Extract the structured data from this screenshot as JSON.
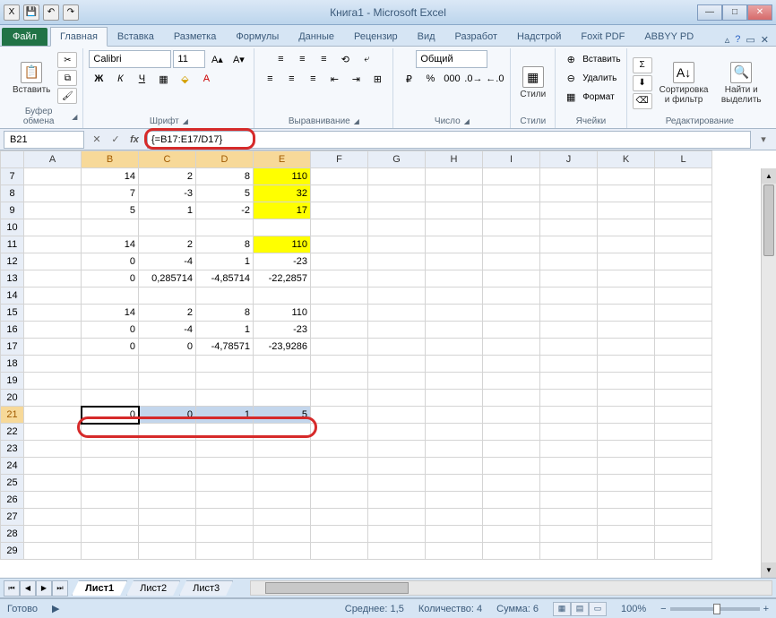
{
  "window": {
    "title": "Книга1 - Microsoft Excel"
  },
  "qat": {
    "save": "💾",
    "undo": "↶",
    "redo": "↷"
  },
  "tabs": {
    "file": "Файл",
    "items": [
      "Главная",
      "Вставка",
      "Разметка",
      "Формулы",
      "Данные",
      "Рецензир",
      "Вид",
      "Разработ",
      "Надстрой",
      "Foxit PDF",
      "ABBYY PD"
    ],
    "active": 0
  },
  "ribbon": {
    "clipboard": {
      "paste": "Вставить",
      "label": "Буфер обмена"
    },
    "font": {
      "name": "Calibri",
      "size": "11",
      "label": "Шрифт"
    },
    "align": {
      "label": "Выравнивание"
    },
    "number": {
      "format": "Общий",
      "label": "Число"
    },
    "styles": {
      "btn": "Стили",
      "label": "Стили"
    },
    "cells": {
      "insert": "Вставить",
      "delete": "Удалить",
      "format": "Формат",
      "label": "Ячейки"
    },
    "editing": {
      "sort": "Сортировка и фильтр",
      "find": "Найти и выделить",
      "label": "Редактирование"
    }
  },
  "name_box": "B21",
  "formula": "{=B17:E17/D17}",
  "columns": [
    "A",
    "B",
    "C",
    "D",
    "E",
    "F",
    "G",
    "H",
    "I",
    "J",
    "K",
    "L"
  ],
  "rows": [
    {
      "n": 7,
      "cells": [
        "",
        "14",
        "2",
        "8",
        "110",
        "",
        "",
        "",
        "",
        "",
        "",
        ""
      ],
      "yellow": [
        4
      ]
    },
    {
      "n": 8,
      "cells": [
        "",
        "7",
        "-3",
        "5",
        "32",
        "",
        "",
        "",
        "",
        "",
        "",
        ""
      ],
      "yellow": [
        4
      ]
    },
    {
      "n": 9,
      "cells": [
        "",
        "5",
        "1",
        "-2",
        "17",
        "",
        "",
        "",
        "",
        "",
        "",
        ""
      ],
      "yellow": [
        4
      ]
    },
    {
      "n": 10,
      "cells": [
        "",
        "",
        "",
        "",
        "",
        "",
        "",
        "",
        "",
        "",
        "",
        ""
      ]
    },
    {
      "n": 11,
      "cells": [
        "",
        "14",
        "2",
        "8",
        "110",
        "",
        "",
        "",
        "",
        "",
        "",
        ""
      ],
      "yellow": [
        4
      ]
    },
    {
      "n": 12,
      "cells": [
        "",
        "0",
        "-4",
        "1",
        "-23",
        "",
        "",
        "",
        "",
        "",
        "",
        ""
      ]
    },
    {
      "n": 13,
      "cells": [
        "",
        "0",
        "0,285714",
        "-4,85714",
        "-22,2857",
        "",
        "",
        "",
        "",
        "",
        "",
        ""
      ]
    },
    {
      "n": 14,
      "cells": [
        "",
        "",
        "",
        "",
        "",
        "",
        "",
        "",
        "",
        "",
        "",
        ""
      ]
    },
    {
      "n": 15,
      "cells": [
        "",
        "14",
        "2",
        "8",
        "110",
        "",
        "",
        "",
        "",
        "",
        "",
        ""
      ]
    },
    {
      "n": 16,
      "cells": [
        "",
        "0",
        "-4",
        "1",
        "-23",
        "",
        "",
        "",
        "",
        "",
        "",
        ""
      ]
    },
    {
      "n": 17,
      "cells": [
        "",
        "0",
        "0",
        "-4,78571",
        "-23,9286",
        "",
        "",
        "",
        "",
        "",
        "",
        ""
      ]
    },
    {
      "n": 18,
      "cells": [
        "",
        "",
        "",
        "",
        "",
        "",
        "",
        "",
        "",
        "",
        "",
        ""
      ]
    },
    {
      "n": 19,
      "cells": [
        "",
        "",
        "",
        "",
        "",
        "",
        "",
        "",
        "",
        "",
        "",
        ""
      ]
    },
    {
      "n": 20,
      "cells": [
        "",
        "",
        "",
        "",
        "",
        "",
        "",
        "",
        "",
        "",
        "",
        ""
      ]
    },
    {
      "n": 21,
      "cells": [
        "",
        "0",
        "0",
        "1",
        "5",
        "",
        "",
        "",
        "",
        "",
        "",
        ""
      ],
      "sel": [
        1,
        2,
        3,
        4
      ],
      "selFirst": 1
    },
    {
      "n": 22,
      "cells": [
        "",
        "",
        "",
        "",
        "",
        "",
        "",
        "",
        "",
        "",
        "",
        ""
      ]
    },
    {
      "n": 23,
      "cells": [
        "",
        "",
        "",
        "",
        "",
        "",
        "",
        "",
        "",
        "",
        "",
        ""
      ]
    },
    {
      "n": 24,
      "cells": [
        "",
        "",
        "",
        "",
        "",
        "",
        "",
        "",
        "",
        "",
        "",
        ""
      ]
    },
    {
      "n": 25,
      "cells": [
        "",
        "",
        "",
        "",
        "",
        "",
        "",
        "",
        "",
        "",
        "",
        ""
      ]
    },
    {
      "n": 26,
      "cells": [
        "",
        "",
        "",
        "",
        "",
        "",
        "",
        "",
        "",
        "",
        "",
        ""
      ]
    },
    {
      "n": 27,
      "cells": [
        "",
        "",
        "",
        "",
        "",
        "",
        "",
        "",
        "",
        "",
        "",
        ""
      ]
    },
    {
      "n": 28,
      "cells": [
        "",
        "",
        "",
        "",
        "",
        "",
        "",
        "",
        "",
        "",
        "",
        ""
      ]
    },
    {
      "n": 29,
      "cells": [
        "",
        "",
        "",
        "",
        "",
        "",
        "",
        "",
        "",
        "",
        "",
        ""
      ]
    }
  ],
  "active_cols": [
    "B",
    "C",
    "D",
    "E"
  ],
  "active_row": 21,
  "sheets": {
    "items": [
      "Лист1",
      "Лист2",
      "Лист3"
    ],
    "active": 0
  },
  "status": {
    "ready": "Готово",
    "avg_lbl": "Среднее:",
    "avg": "1,5",
    "count_lbl": "Количество:",
    "count": "4",
    "sum_lbl": "Сумма:",
    "sum": "6",
    "zoom": "100%"
  }
}
